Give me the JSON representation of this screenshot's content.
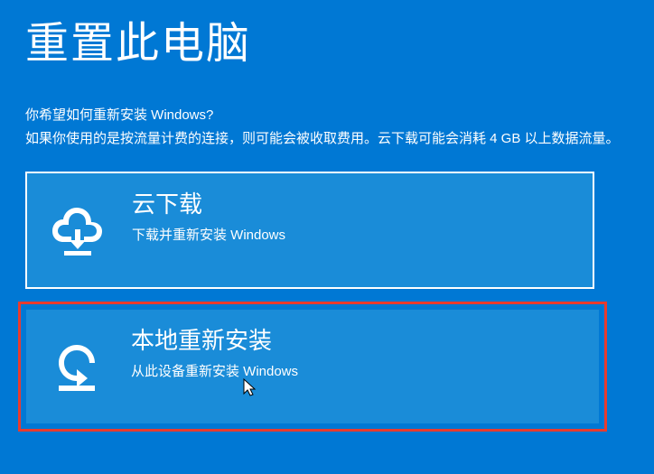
{
  "title": "重置此电脑",
  "question": "你希望如何重新安装 Windows?",
  "warning": "如果你使用的是按流量计费的连接，则可能会被收取费用。云下载可能会消耗 4 GB 以上数据流量。",
  "options": [
    {
      "title": "云下载",
      "desc": "下载并重新安装 Windows"
    },
    {
      "title": "本地重新安装",
      "desc": "从此设备重新安装 Windows"
    }
  ]
}
